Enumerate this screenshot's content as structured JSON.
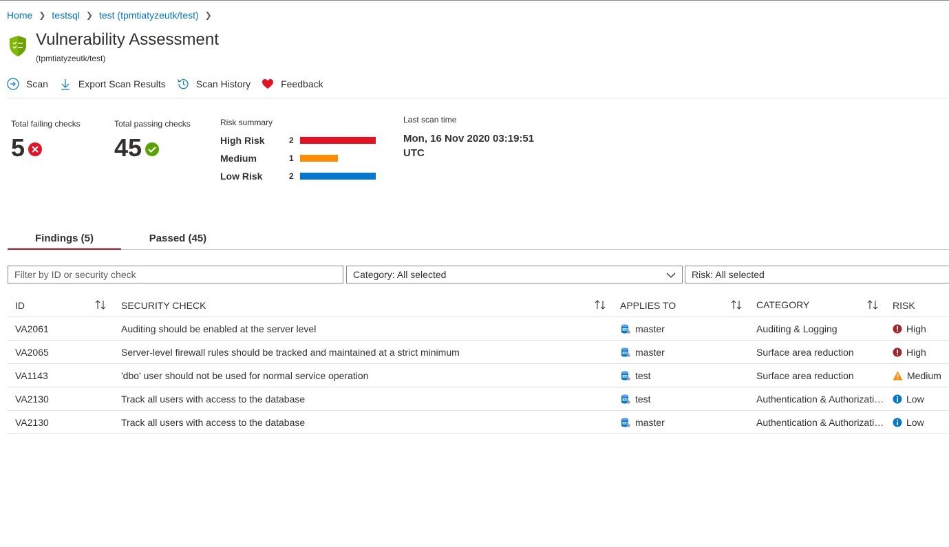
{
  "breadcrumb": [
    "Home",
    "testsql",
    "test (tpmtiatyzeutk/test)"
  ],
  "title": "Vulnerability Assessment",
  "subtitle": "(tpmtiatyzeutk/test)",
  "toolbar": {
    "scan": "Scan",
    "export": "Export Scan Results",
    "history": "Scan History",
    "feedback": "Feedback"
  },
  "stats": {
    "failing_label": "Total failing checks",
    "failing_value": "5",
    "passing_label": "Total passing checks",
    "passing_value": "45"
  },
  "risk_summary": {
    "label": "Risk summary",
    "rows": [
      {
        "name": "High Risk",
        "count": 2,
        "color": "#e81123"
      },
      {
        "name": "Medium",
        "count": 1,
        "color": "#ff8c00"
      },
      {
        "name": "Low Risk",
        "count": 2,
        "color": "#0078d4"
      }
    ]
  },
  "last_scan": {
    "label": "Last scan time",
    "line1": "Mon, 16 Nov 2020 03:19:51",
    "line2": "UTC"
  },
  "tabs": [
    "Findings (5)",
    "Passed (45)"
  ],
  "filters": {
    "search_placeholder": "Filter by ID or security check",
    "category": "Category: All selected",
    "risk": "Risk: All selected"
  },
  "columns": [
    "ID",
    "SECURITY CHECK",
    "APPLIES TO",
    "CATEGORY",
    "RISK"
  ],
  "rows": [
    {
      "id": "VA2061",
      "check": "Auditing should be enabled at the server level",
      "applies": "master",
      "category": "Auditing & Logging",
      "risk": "High"
    },
    {
      "id": "VA2065",
      "check": "Server-level firewall rules should be tracked and maintained at a strict minimum",
      "applies": "master",
      "category": "Surface area reduction",
      "risk": "High"
    },
    {
      "id": "VA1143",
      "check": "'dbo' user should not be used for normal service operation",
      "applies": "test",
      "category": "Surface area reduction",
      "risk": "Medium"
    },
    {
      "id": "VA2130",
      "check": "Track all users with access to the database",
      "applies": "test",
      "category": "Authentication & Authorization",
      "risk": "Low"
    },
    {
      "id": "VA2130",
      "check": "Track all users with access to the database",
      "applies": "master",
      "category": "Authentication & Authorization",
      "risk": "Low"
    }
  ],
  "colors": {
    "accent": "#0078d4",
    "high": "#a4262c",
    "medium": "#ff8c00",
    "low": "#0078d4",
    "fail": "#e81123",
    "pass": "#57a300"
  }
}
